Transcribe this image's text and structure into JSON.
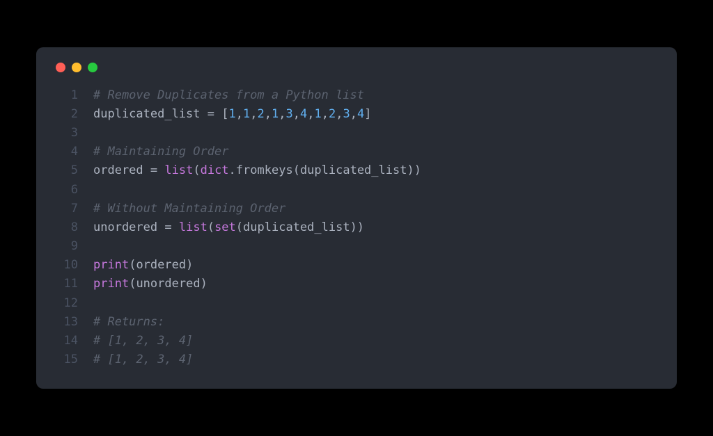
{
  "lines": [
    {
      "n": "1",
      "tokens": [
        {
          "cls": "comment",
          "t": "# Remove Duplicates from a Python list"
        }
      ]
    },
    {
      "n": "2",
      "tokens": [
        {
          "cls": "default",
          "t": "duplicated_list "
        },
        {
          "cls": "op",
          "t": "="
        },
        {
          "cls": "default",
          "t": " "
        },
        {
          "cls": "punct",
          "t": "["
        },
        {
          "cls": "num",
          "t": "1"
        },
        {
          "cls": "punct",
          "t": ","
        },
        {
          "cls": "num",
          "t": "1"
        },
        {
          "cls": "punct",
          "t": ","
        },
        {
          "cls": "num",
          "t": "2"
        },
        {
          "cls": "punct",
          "t": ","
        },
        {
          "cls": "num",
          "t": "1"
        },
        {
          "cls": "punct",
          "t": ","
        },
        {
          "cls": "num",
          "t": "3"
        },
        {
          "cls": "punct",
          "t": ","
        },
        {
          "cls": "num",
          "t": "4"
        },
        {
          "cls": "punct",
          "t": ","
        },
        {
          "cls": "num",
          "t": "1"
        },
        {
          "cls": "punct",
          "t": ","
        },
        {
          "cls": "num",
          "t": "2"
        },
        {
          "cls": "punct",
          "t": ","
        },
        {
          "cls": "num",
          "t": "3"
        },
        {
          "cls": "punct",
          "t": ","
        },
        {
          "cls": "num",
          "t": "4"
        },
        {
          "cls": "punct",
          "t": "]"
        }
      ]
    },
    {
      "n": "3",
      "tokens": []
    },
    {
      "n": "4",
      "tokens": [
        {
          "cls": "comment",
          "t": "# Maintaining Order"
        }
      ]
    },
    {
      "n": "5",
      "tokens": [
        {
          "cls": "default",
          "t": "ordered "
        },
        {
          "cls": "op",
          "t": "="
        },
        {
          "cls": "default",
          "t": " "
        },
        {
          "cls": "func",
          "t": "list"
        },
        {
          "cls": "paren",
          "t": "("
        },
        {
          "cls": "func",
          "t": "dict"
        },
        {
          "cls": "default",
          "t": "."
        },
        {
          "cls": "default",
          "t": "fromkeys"
        },
        {
          "cls": "paren",
          "t": "("
        },
        {
          "cls": "default",
          "t": "duplicated_list"
        },
        {
          "cls": "paren",
          "t": "))"
        }
      ]
    },
    {
      "n": "6",
      "tokens": []
    },
    {
      "n": "7",
      "tokens": [
        {
          "cls": "comment",
          "t": "# Without Maintaining Order"
        }
      ]
    },
    {
      "n": "8",
      "tokens": [
        {
          "cls": "default",
          "t": "unordered "
        },
        {
          "cls": "op",
          "t": "="
        },
        {
          "cls": "default",
          "t": " "
        },
        {
          "cls": "func",
          "t": "list"
        },
        {
          "cls": "paren",
          "t": "("
        },
        {
          "cls": "func",
          "t": "set"
        },
        {
          "cls": "paren",
          "t": "("
        },
        {
          "cls": "default",
          "t": "duplicated_list"
        },
        {
          "cls": "paren",
          "t": "))"
        }
      ]
    },
    {
      "n": "9",
      "tokens": []
    },
    {
      "n": "10",
      "tokens": [
        {
          "cls": "func",
          "t": "print"
        },
        {
          "cls": "paren",
          "t": "("
        },
        {
          "cls": "default",
          "t": "ordered"
        },
        {
          "cls": "paren",
          "t": ")"
        }
      ]
    },
    {
      "n": "11",
      "tokens": [
        {
          "cls": "func",
          "t": "print"
        },
        {
          "cls": "paren",
          "t": "("
        },
        {
          "cls": "default",
          "t": "unordered"
        },
        {
          "cls": "paren",
          "t": ")"
        }
      ]
    },
    {
      "n": "12",
      "tokens": []
    },
    {
      "n": "13",
      "tokens": [
        {
          "cls": "comment",
          "t": "# Returns:"
        }
      ]
    },
    {
      "n": "14",
      "tokens": [
        {
          "cls": "comment",
          "t": "# [1, 2, 3, 4]"
        }
      ]
    },
    {
      "n": "15",
      "tokens": [
        {
          "cls": "comment",
          "t": "# [1, 2, 3, 4]"
        }
      ]
    }
  ]
}
